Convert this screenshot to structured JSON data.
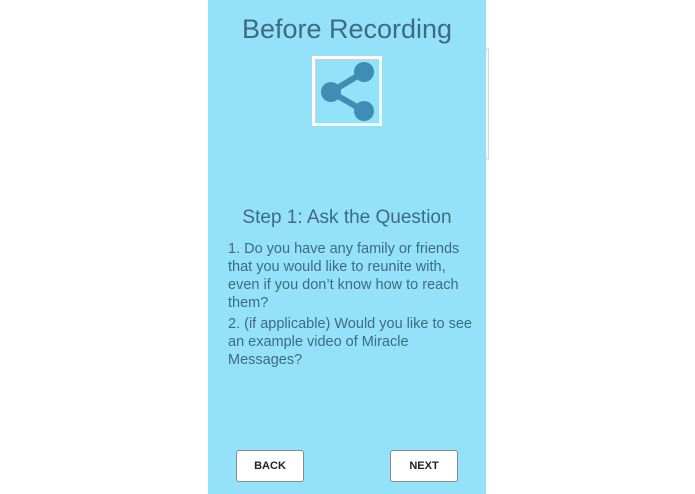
{
  "screen": {
    "title": "Before Recording",
    "background_color": "#94e2fa",
    "text_color": "#3e6b80"
  },
  "share": {
    "icon": "share-icon",
    "icon_color": "#3d8db5"
  },
  "step": {
    "title": "Step 1: Ask the Question",
    "questions": [
      "1. Do you have any family or friends that you would like to reunite with, even if you don’t know how to reach them?",
      "2. (if applicable) Would you like to see an example video of Miracle Messages?"
    ]
  },
  "navigation": {
    "back_label": "BACK",
    "next_label": "NEXT"
  }
}
